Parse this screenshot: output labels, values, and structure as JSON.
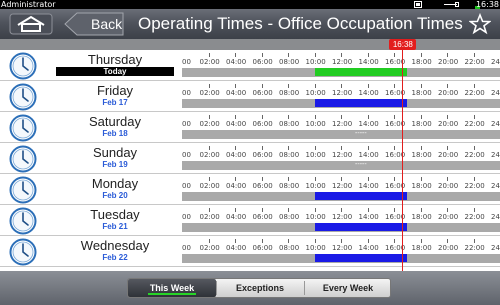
{
  "status": {
    "user": "Administrator",
    "clock": "16:38",
    "icons": [
      "display-icon",
      "usb-icon",
      "battery-icon"
    ],
    "battery_color": "#1cc21c"
  },
  "titlebar": {
    "home_icon": "home-icon",
    "back_label": "Back",
    "title": "Operating Times - Office Occupation Times",
    "favorite_icon": "star-icon"
  },
  "timeline": {
    "now_label": "16:38",
    "now_hours": 16.633,
    "tick_labels": [
      "00",
      "02:00",
      "04:00",
      "06:00",
      "08:00",
      "10:00",
      "12:00",
      "14:00",
      "16:00",
      "18:00",
      "20:00",
      "22:00",
      "24"
    ],
    "colors": {
      "active_today": "#22cc22",
      "active": "#1a1ae6",
      "inactive": "#a9a9a9",
      "now": "#e21d1d"
    }
  },
  "days": [
    {
      "name": "Thursday",
      "date": "Today",
      "today": true,
      "start": 10.0,
      "end": 17.0,
      "kind": "active_today"
    },
    {
      "name": "Friday",
      "date": "Feb 17",
      "today": false,
      "start": 10.0,
      "end": 17.0,
      "kind": "active"
    },
    {
      "name": "Saturday",
      "date": "Feb 18",
      "today": false,
      "empty_label": "-----"
    },
    {
      "name": "Sunday",
      "date": "Feb 19",
      "today": false,
      "empty_label": "-----"
    },
    {
      "name": "Monday",
      "date": "Feb 20",
      "today": false,
      "start": 10.0,
      "end": 17.0,
      "kind": "active"
    },
    {
      "name": "Tuesday",
      "date": "Feb 21",
      "today": false,
      "start": 10.0,
      "end": 17.0,
      "kind": "active"
    },
    {
      "name": "Wednesday",
      "date": "Feb 22",
      "today": false,
      "start": 10.0,
      "end": 17.0,
      "kind": "active"
    }
  ],
  "footer": {
    "tabs": [
      {
        "label": "This Week",
        "active": true
      },
      {
        "label": "Exceptions",
        "active": false
      },
      {
        "label": "Every Week",
        "active": false
      }
    ]
  }
}
